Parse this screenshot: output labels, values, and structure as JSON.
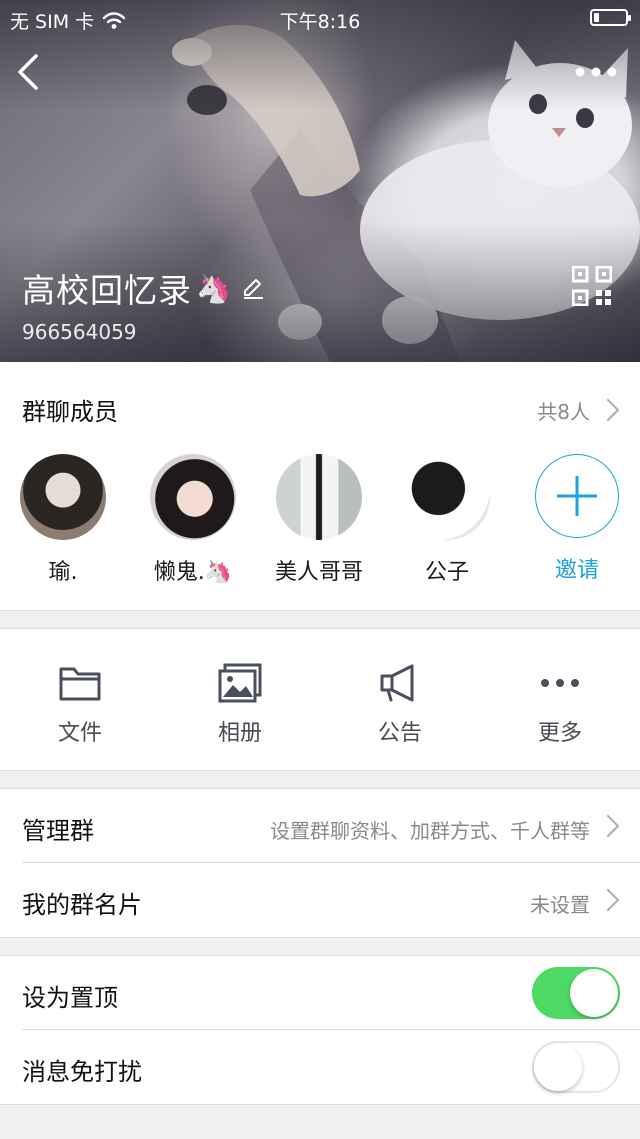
{
  "status_bar": {
    "carrier": "无 SIM 卡",
    "time": "下午8:16",
    "battery_level": 0.18
  },
  "header": {
    "group_name": "高校回忆录",
    "group_emoji": "🦄",
    "group_id": "966564059"
  },
  "members": {
    "title": "群聊成员",
    "count_label": "共8人",
    "list": [
      {
        "name": "瑜.",
        "emoji": ""
      },
      {
        "name": "懒鬼.",
        "emoji": "🦄"
      },
      {
        "name": "美人哥哥",
        "emoji": ""
      },
      {
        "name": "公子",
        "emoji": ""
      }
    ],
    "invite_label": "邀请"
  },
  "tools": [
    {
      "label": "文件",
      "icon": "folder-icon"
    },
    {
      "label": "相册",
      "icon": "photo-album-icon"
    },
    {
      "label": "公告",
      "icon": "megaphone-icon"
    },
    {
      "label": "更多",
      "icon": "more-dots-icon"
    }
  ],
  "manage": {
    "manage_group_label": "管理群",
    "manage_group_hint": "设置群聊资料、加群方式、千人群等",
    "card_label": "我的群名片",
    "card_value": "未设置"
  },
  "toggles": {
    "pin_label": "设为置顶",
    "pin_on": true,
    "mute_label": "消息免打扰",
    "mute_on": false
  },
  "colors": {
    "accent": "#1aa3dc",
    "switch_on": "#4cd964"
  }
}
